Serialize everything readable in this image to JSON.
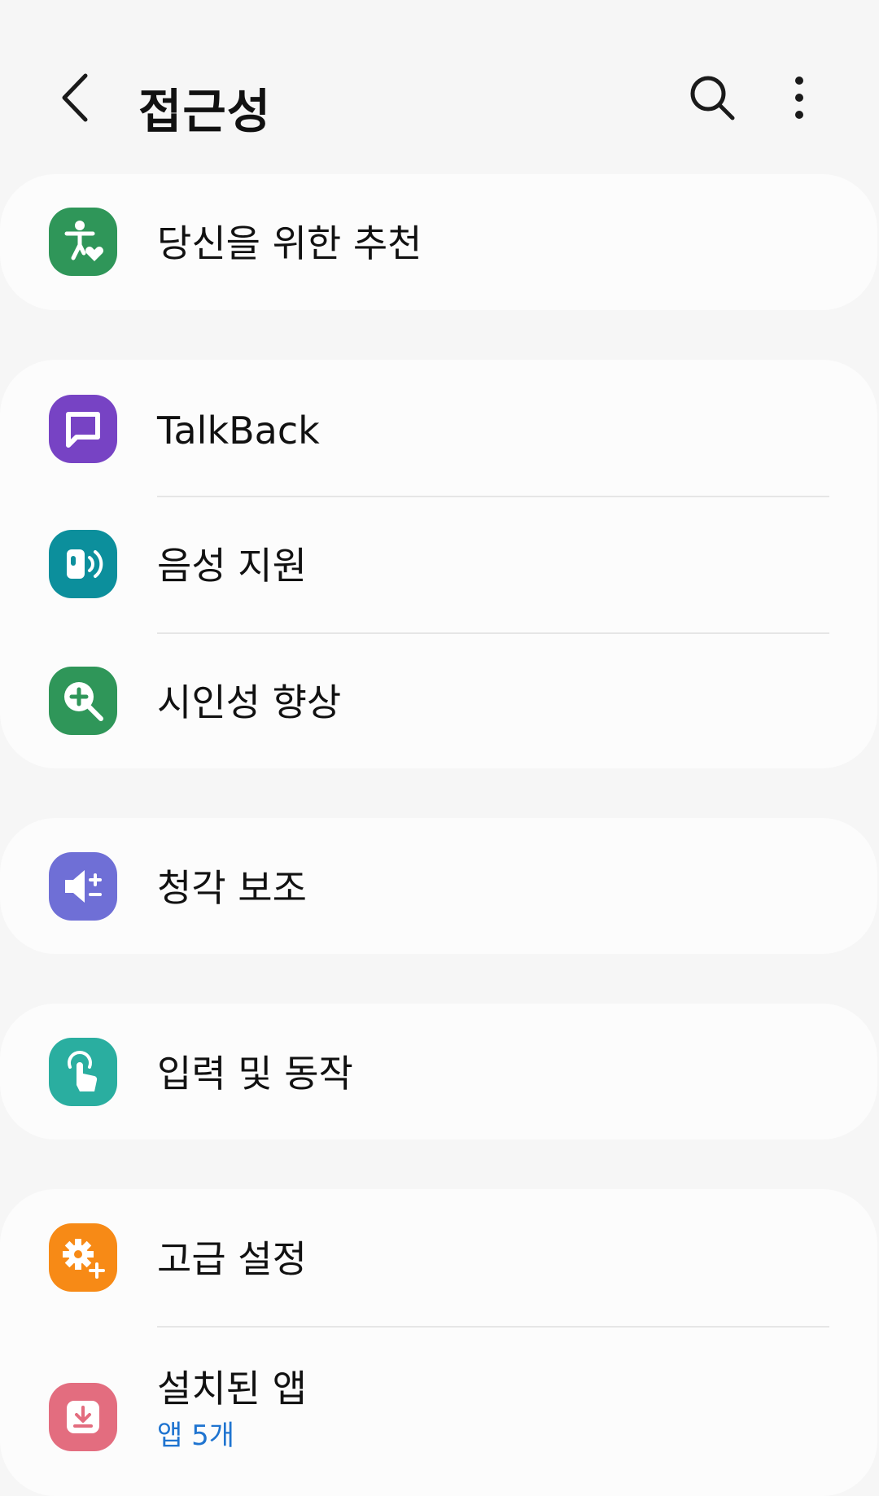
{
  "header": {
    "title": "접근성",
    "back_icon": "chevron-left-icon",
    "search_icon": "search-icon",
    "more_icon": "more-vert-icon"
  },
  "groups": [
    {
      "items": [
        {
          "label": "당신을 위한 추천",
          "icon": "accessibility-heart-icon",
          "icon_color": "#2f9659"
        }
      ]
    },
    {
      "items": [
        {
          "label": "TalkBack",
          "icon": "speech-bubble-icon",
          "icon_color": "#7743c4"
        },
        {
          "label": "음성 지원",
          "icon": "speaker-voice-icon",
          "icon_color": "#0c8f9c"
        },
        {
          "label": "시인성 향상",
          "icon": "magnify-plus-icon",
          "icon_color": "#2f9659"
        }
      ]
    },
    {
      "items": [
        {
          "label": "청각 보조",
          "icon": "volume-plus-minus-icon",
          "icon_color": "#6f6fd6"
        }
      ]
    },
    {
      "items": [
        {
          "label": "입력 및 동작",
          "icon": "touch-hand-icon",
          "icon_color": "#2aaea0"
        }
      ]
    },
    {
      "items": [
        {
          "label": "고급 설정",
          "icon": "gear-plus-icon",
          "icon_color": "#f78a16"
        },
        {
          "label": "설치된 앱",
          "sub": "앱 5개",
          "sub_color": "#1f74d0",
          "icon": "download-box-icon",
          "icon_color": "#e36d7f"
        }
      ]
    }
  ]
}
